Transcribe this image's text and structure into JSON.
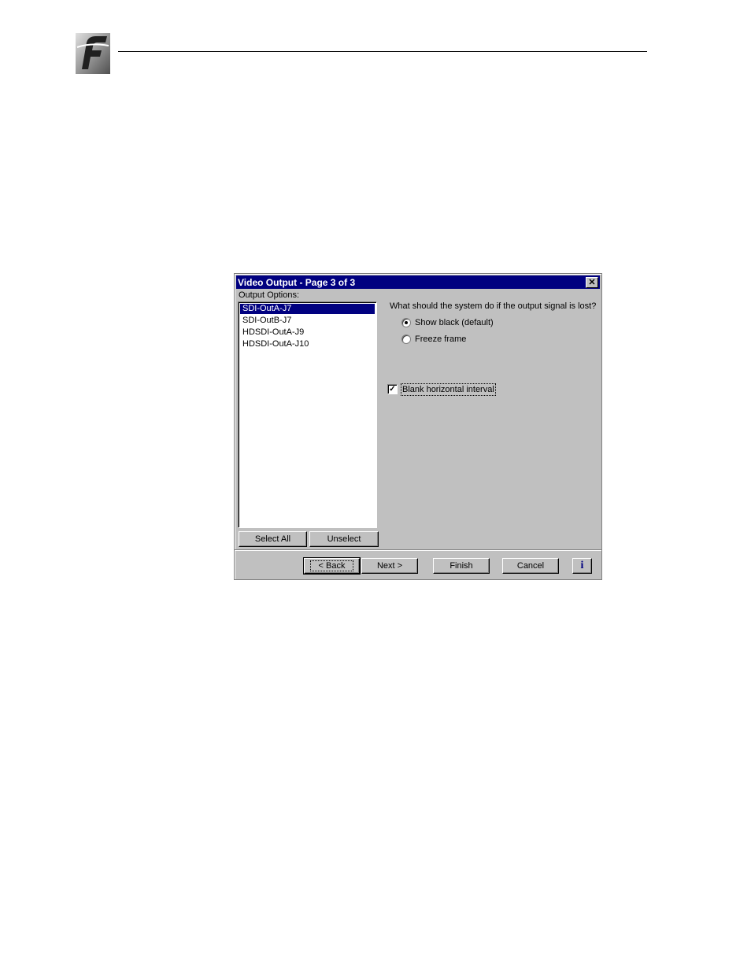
{
  "dialog": {
    "title": "Video Output - Page 3 of 3",
    "close_icon": "close-icon",
    "output_options_label": "Output Options:",
    "outputs": [
      {
        "label": "SDI-OutA-J7",
        "selected": true
      },
      {
        "label": "SDI-OutB-J7",
        "selected": false
      },
      {
        "label": "HDSDI-OutA-J9",
        "selected": false
      },
      {
        "label": "HDSDI-OutA-J10",
        "selected": false
      }
    ],
    "select_all_label": "Select All",
    "unselect_label": "Unselect",
    "question": "What should the system do if the output signal is lost?",
    "radio_show_black": "Show black (default)",
    "radio_freeze_frame": "Freeze frame",
    "checkbox_blank_horizontal": "Blank horizontal interval",
    "back_label": "< Back",
    "next_label": "Next >",
    "finish_label": "Finish",
    "cancel_label": "Cancel",
    "info_label": "i"
  },
  "colors": {
    "titlebar": "#000080",
    "dialog_face": "#c0c0c0",
    "selection": "#000080"
  }
}
